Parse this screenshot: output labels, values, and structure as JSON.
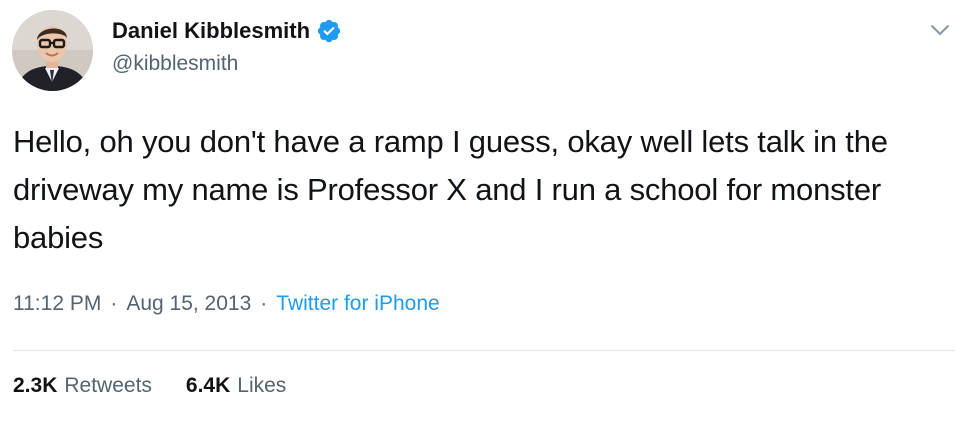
{
  "user": {
    "display_name": "Daniel Kibblesmith",
    "handle": "@kibblesmith",
    "verified": true,
    "verified_icon": "verified-badge-icon",
    "avatar_icon": "profile-photo"
  },
  "tweet": {
    "text": "Hello, oh you don't have a ramp I guess, okay well lets talk in the driveway my name is Professor X and I run a school for monster babies",
    "time": "11:12 PM",
    "date": "Aug 15, 2013",
    "separator": "·",
    "source": "Twitter for iPhone"
  },
  "stats": {
    "retweets_count": "2.3K",
    "retweets_label": "Retweets",
    "likes_count": "6.4K",
    "likes_label": "Likes"
  },
  "menu": {
    "icon": "chevron-down-icon"
  },
  "colors": {
    "accent": "#1d9bf0",
    "text_primary": "#0f1419",
    "text_secondary": "#536471",
    "divider": "#e1e8ed"
  }
}
